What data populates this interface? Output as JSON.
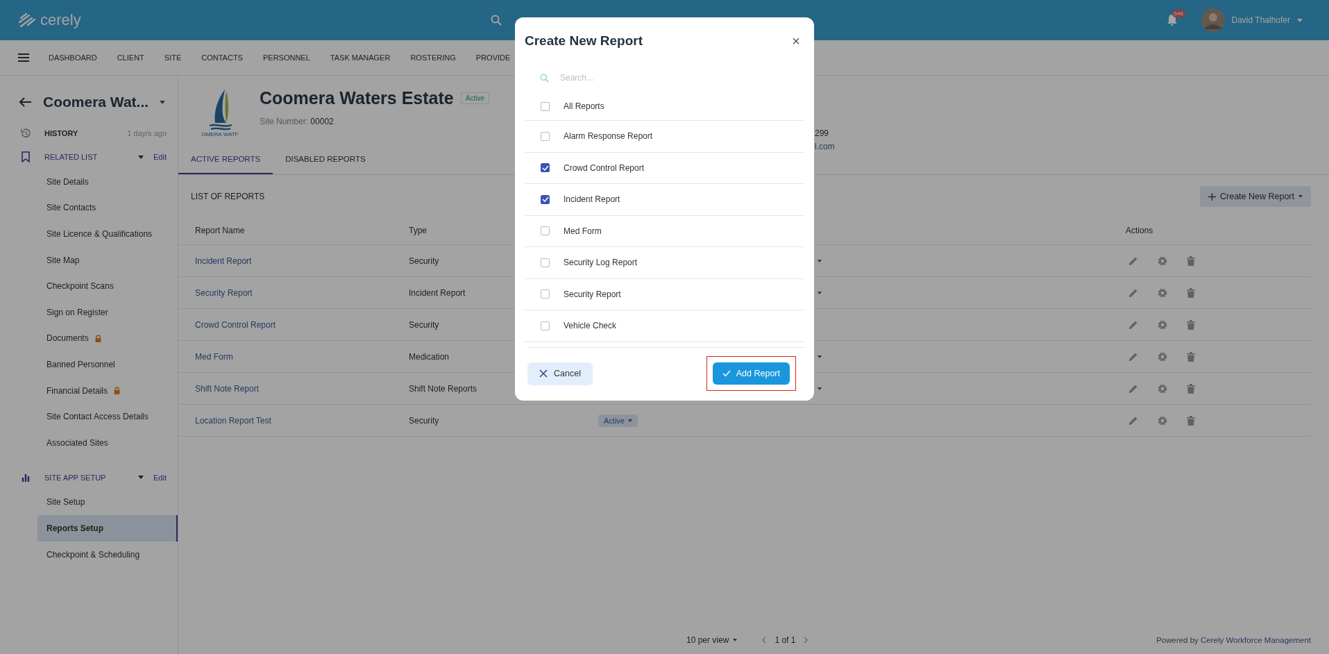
{
  "topbar": {
    "logo": "cerely",
    "notification_count": "648",
    "user_name": "David Thalhofer"
  },
  "nav": {
    "items": [
      "DASHBOARD",
      "CLIENT",
      "SITE",
      "CONTACTS",
      "PERSONNEL",
      "TASK MANAGER",
      "ROSTERING",
      "PROVIDE"
    ]
  },
  "sidebar": {
    "site_name": "Coomera Wat...",
    "history": {
      "label": "HISTORY",
      "time": "1 day/s ago"
    },
    "sections": [
      {
        "kind": "bookmark",
        "title": "RELATED LIST",
        "edit": "Edit",
        "items": [
          {
            "label": "Site Details",
            "locked": false,
            "selected": false
          },
          {
            "label": "Site Contacts",
            "locked": false,
            "selected": false
          },
          {
            "label": "Site Licence & Qualifications",
            "locked": false,
            "selected": false
          },
          {
            "label": "Site Map",
            "locked": false,
            "selected": false
          },
          {
            "label": "Checkpoint Scans",
            "locked": false,
            "selected": false
          },
          {
            "label": "Sign on Register",
            "locked": false,
            "selected": false
          },
          {
            "label": "Documents",
            "locked": true,
            "selected": false
          },
          {
            "label": "Banned Personnel",
            "locked": false,
            "selected": false
          },
          {
            "label": "Financial Details",
            "locked": true,
            "selected": false
          },
          {
            "label": "Site Contact Access Details",
            "locked": false,
            "selected": false
          },
          {
            "label": "Associated Sites",
            "locked": false,
            "selected": false
          }
        ]
      },
      {
        "kind": "chart",
        "title": "SITE APP SETUP",
        "edit": "Edit",
        "items": [
          {
            "label": "Site Setup",
            "locked": false,
            "selected": false
          },
          {
            "label": "Reports Setup",
            "locked": false,
            "selected": true
          },
          {
            "label": "Checkpoint & Scheduling",
            "locked": false,
            "selected": false
          }
        ]
      }
    ]
  },
  "site": {
    "logo_text": "OMERA WATF",
    "name": "Coomera Waters Estate",
    "status": "Active",
    "number_label": "Site Number:",
    "number": "00002",
    "contact_phone": "299",
    "contact_email": "l.com"
  },
  "tabs": [
    {
      "label": "ACTIVE REPORTS",
      "selected": true
    },
    {
      "label": "DISABLED REPORTS",
      "selected": false
    }
  ],
  "list": {
    "title": "LIST OF REPORTS",
    "create_button": "Create New Report",
    "columns": [
      "Report Name",
      "Type",
      "Actions"
    ],
    "rows": [
      {
        "name": "Incident Report",
        "type": "Security",
        "status_caret": true
      },
      {
        "name": "Security Report",
        "type": "Incident Report",
        "status_caret": true
      },
      {
        "name": "Crowd Control Report",
        "type": "Security"
      },
      {
        "name": "Med Form",
        "type": "Medication",
        "status_caret": true
      },
      {
        "name": "Shift Note Report",
        "type": "Shift Note Reports",
        "status_caret": true
      },
      {
        "name": "Location Report Test",
        "type": "Security",
        "status": "Active"
      }
    ]
  },
  "pagination": {
    "per_view": "10 per view",
    "page": "1 of 1"
  },
  "footer": {
    "prefix": "Powered by",
    "link": "Cerely Workforce Management"
  },
  "modal": {
    "title": "Create New Report",
    "close": "×",
    "search_placeholder": "Search...",
    "options": [
      {
        "label": "All Reports",
        "checked": false
      },
      {
        "label": "Alarm Response Report",
        "checked": false
      },
      {
        "label": "Crowd Control Report",
        "checked": true
      },
      {
        "label": "Incident Report",
        "checked": true
      },
      {
        "label": "Med Form",
        "checked": false
      },
      {
        "label": "Security Log Report",
        "checked": false
      },
      {
        "label": "Security Report",
        "checked": false
      },
      {
        "label": "Vehicle Check",
        "checked": false
      }
    ],
    "cancel": "Cancel",
    "confirm": "Add Report",
    "confirm_highlighted": true
  }
}
